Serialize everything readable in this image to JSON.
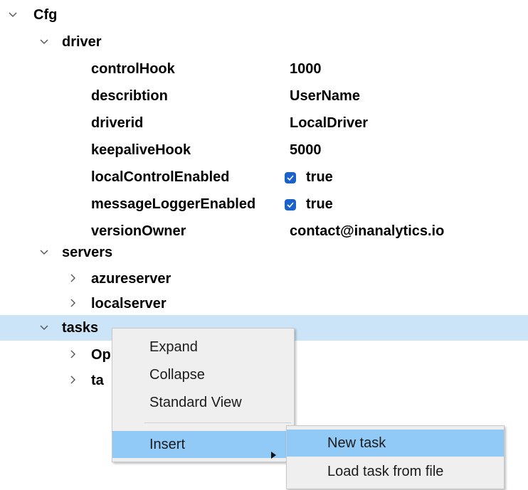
{
  "tree": {
    "root": "Cfg",
    "driver": {
      "label": "driver",
      "props": [
        {
          "key": "controlHook",
          "value": "1000"
        },
        {
          "key": "describtion",
          "value": "UserName"
        },
        {
          "key": "driverid",
          "value": "LocalDriver"
        },
        {
          "key": "keepaliveHook",
          "value": "5000"
        },
        {
          "key": "localControlEnabled",
          "value": "true",
          "checkbox": true
        },
        {
          "key": "messageLoggerEnabled",
          "value": "true",
          "checkbox": true
        },
        {
          "key": "versionOwner",
          "value": "contact@inanalytics.io"
        }
      ]
    },
    "servers": {
      "label": "servers",
      "children": [
        "azureserver",
        "localserver"
      ]
    },
    "tasks": {
      "label": "tasks",
      "children": [
        "Op",
        "ta"
      ]
    }
  },
  "context_menu": {
    "items": [
      "Expand",
      "Collapse",
      "Standard View"
    ],
    "insert": "Insert"
  },
  "submenu": {
    "items": [
      "New task",
      "Load task from file"
    ]
  },
  "colors": {
    "selection": "#cce4f7",
    "menu_highlight": "#91c9f7",
    "checkbox": "#1a62c9"
  }
}
